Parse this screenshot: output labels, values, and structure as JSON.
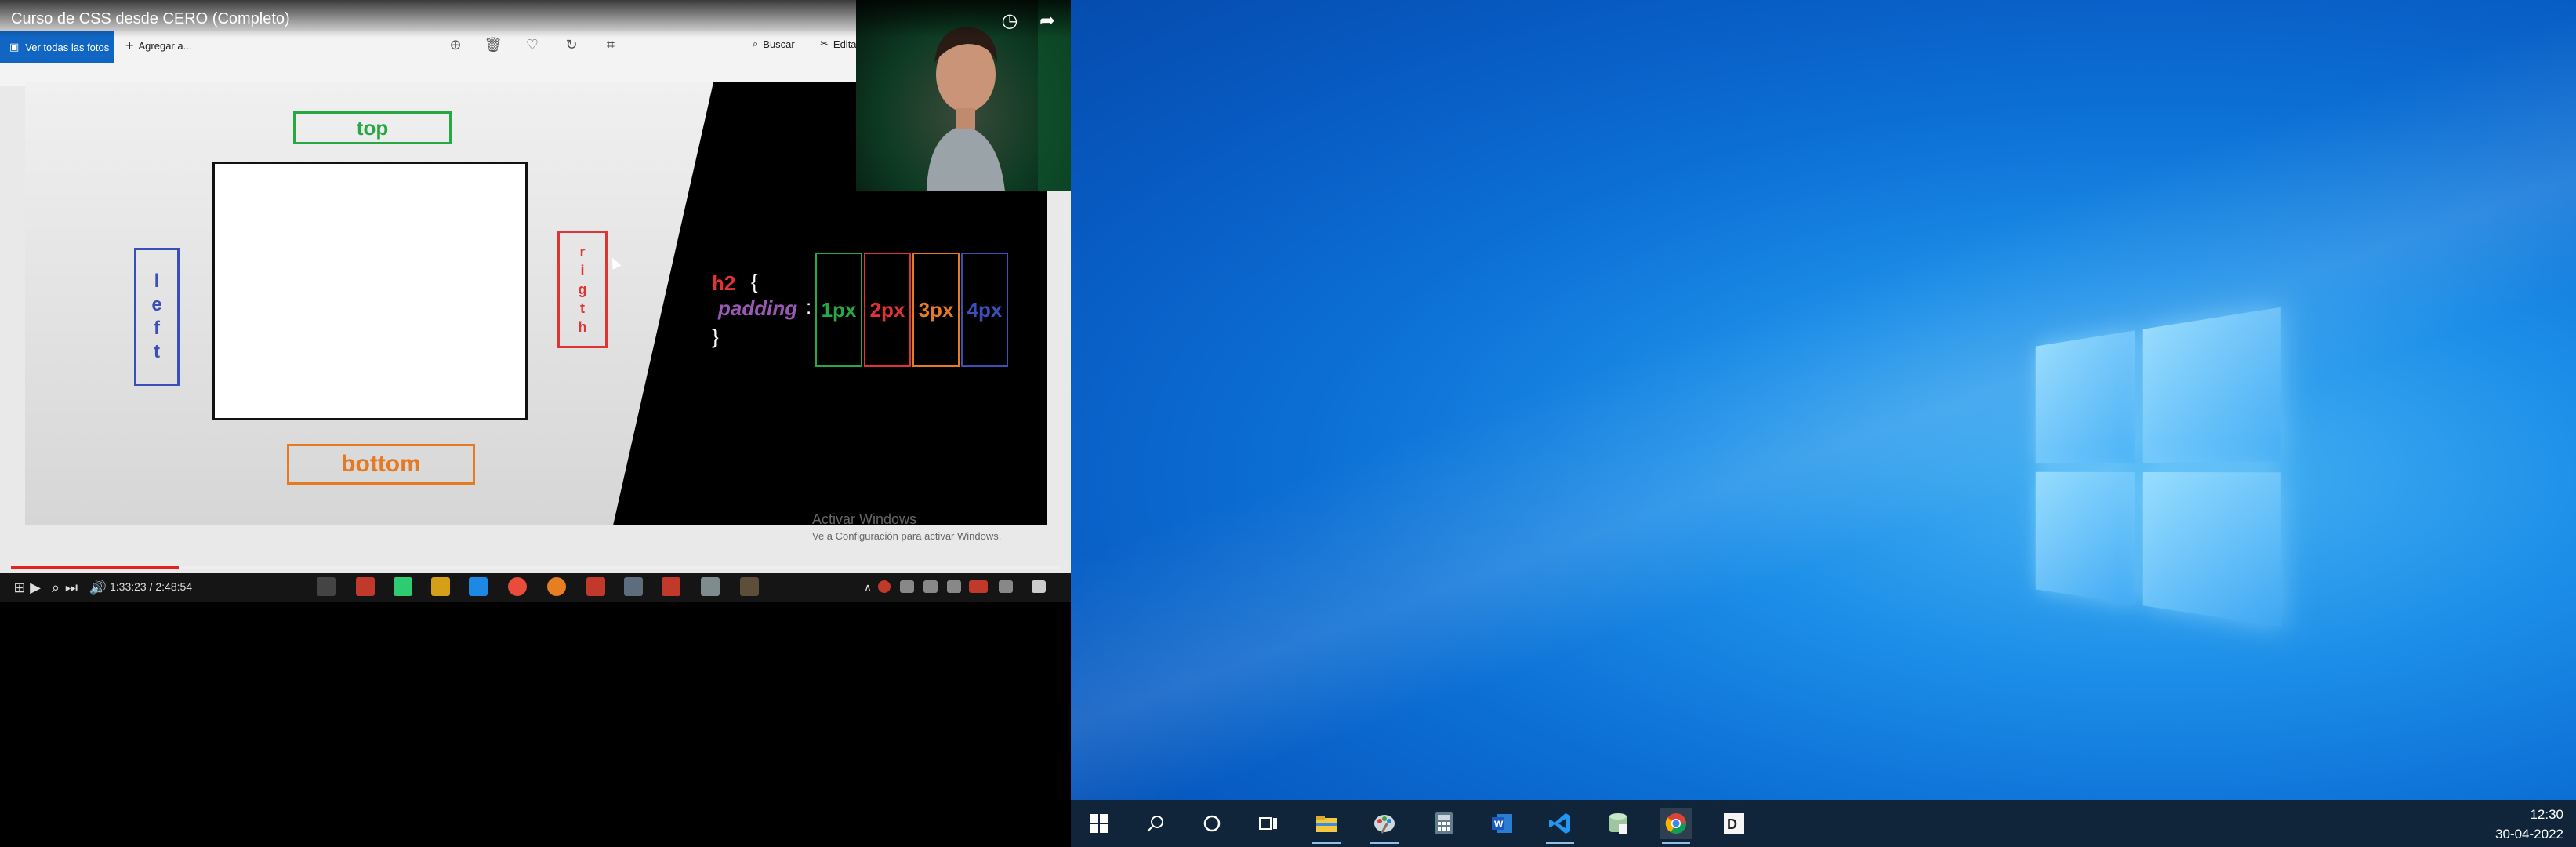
{
  "player": {
    "title": "Curso de CSS desde CERO (Completo)",
    "photos_bar": {
      "view_all": "Ver todas las fotos",
      "add_to": "Agregar a...",
      "search": "Buscar",
      "edit": "Editar"
    },
    "slide": {
      "top": "top",
      "bottom": "bottom",
      "left_letters": [
        "l",
        "e",
        "f",
        "t"
      ],
      "right_letters": [
        "r",
        "i",
        "g",
        "t",
        "h"
      ]
    },
    "code": {
      "selector": "h2",
      "open_brace": "{",
      "property": "padding",
      "colon": ":",
      "values": [
        {
          "text": "1px",
          "color": "#28a745"
        },
        {
          "text": "2px",
          "color": "#e03434"
        },
        {
          "text": "3px",
          "color": "#e57a24"
        },
        {
          "text": "4px",
          "color": "#3a4fb8"
        }
      ],
      "close_brace": "}"
    },
    "watermark": {
      "line1": "Activar Windows",
      "line2": "Ve a Configuración para activar Windows."
    },
    "progress": 0.16,
    "time": "1:33:23 / 2:48:54"
  },
  "desktop": {
    "clock": {
      "time": "12:30",
      "date": "30-04-2022"
    },
    "taskbar_icons": [
      {
        "name": "start-icon"
      },
      {
        "name": "search-icon"
      },
      {
        "name": "cortana-icon"
      },
      {
        "name": "task-view-icon"
      },
      {
        "name": "file-explorer-icon"
      },
      {
        "name": "paint-icon"
      },
      {
        "name": "calculator-icon"
      },
      {
        "name": "word-icon"
      },
      {
        "name": "vscode-icon"
      },
      {
        "name": "database-icon"
      },
      {
        "name": "chrome-icon"
      },
      {
        "name": "app-icon"
      }
    ]
  },
  "colors": {
    "desktop_blue": "#0c6fd4",
    "taskbar": "#10253a",
    "progress_red": "#e52222"
  }
}
